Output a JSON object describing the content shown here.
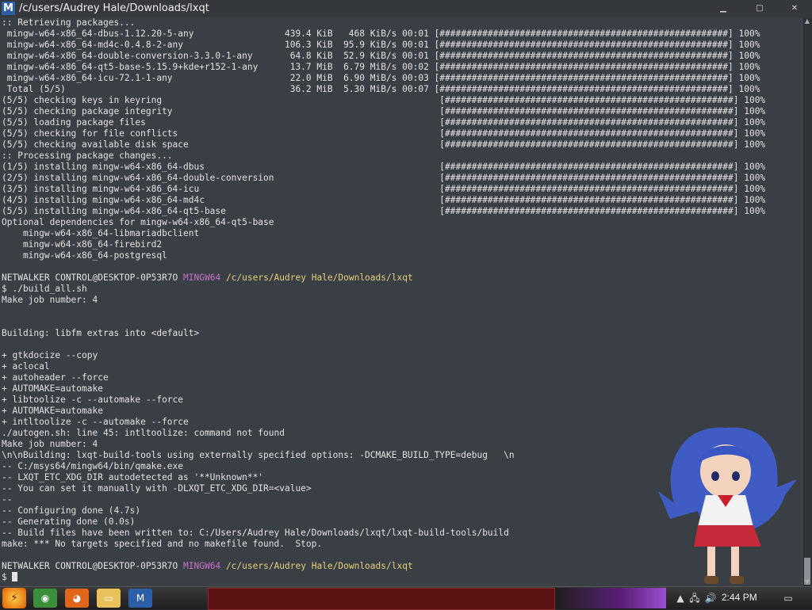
{
  "window": {
    "title": "/c/users/Audrey Hale/Downloads/lxqt",
    "icon_glyph": "M",
    "minimize": "▁",
    "maximize": "□",
    "close": "✕"
  },
  "terminal": {
    "lines": [
      {
        "text": ":: Retrieving packages..."
      },
      {
        "text": " mingw-w64-x86_64-dbus-1.12.20-5-any                 439.4 KiB   468 KiB/s 00:01 [######################################################] 100%"
      },
      {
        "text": " mingw-w64-x86_64-md4c-0.4.8-2-any                   106.3 KiB  95.9 KiB/s 00:01 [######################################################] 100%"
      },
      {
        "text": " mingw-w64-x86_64-double-conversion-3.3.0-1-any       64.8 KiB  52.9 KiB/s 00:01 [######################################################] 100%"
      },
      {
        "text": " mingw-w64-x86_64-qt5-base-5.15.9+kde+r152-1-any      13.7 MiB  6.79 MiB/s 00:02 [######################################################] 100%"
      },
      {
        "text": " mingw-w64-x86_64-icu-72.1-1-any                      22.0 MiB  6.90 MiB/s 00:03 [######################################################] 100%"
      },
      {
        "text": " Total (5/5)                                          36.2 MiB  5.30 MiB/s 00:07 [######################################################] 100%"
      },
      {
        "text": "(5/5) checking keys in keyring                                                    [######################################################] 100%"
      },
      {
        "text": "(5/5) checking package integrity                                                  [######################################################] 100%"
      },
      {
        "text": "(5/5) loading package files                                                       [######################################################] 100%"
      },
      {
        "text": "(5/5) checking for file conflicts                                                 [######################################################] 100%"
      },
      {
        "text": "(5/5) checking available disk space                                               [######################################################] 100%"
      },
      {
        "text": ":: Processing package changes..."
      },
      {
        "text": "(1/5) installing mingw-w64-x86_64-dbus                                            [######################################################] 100%"
      },
      {
        "text": "(2/5) installing mingw-w64-x86_64-double-conversion                               [######################################################] 100%"
      },
      {
        "text": "(3/5) installing mingw-w64-x86_64-icu                                             [######################################################] 100%"
      },
      {
        "text": "(4/5) installing mingw-w64-x86_64-md4c                                            [######################################################] 100%"
      },
      {
        "text": "(5/5) installing mingw-w64-x86_64-qt5-base                                        [######################################################] 100%"
      },
      {
        "text": "Optional dependencies for mingw-w64-x86_64-qt5-base"
      },
      {
        "text": "    mingw-w64-x86_64-libmariadbclient"
      },
      {
        "text": "    mingw-w64-x86_64-firebird2"
      },
      {
        "text": "    mingw-w64-x86_64-postgresql"
      },
      {
        "text": ""
      },
      {
        "prompt": true,
        "host": "NETWALKER CONTROL@DESKTOP-0P53R7O",
        "env": "MINGW64",
        "path": "/c/users/Audrey Hale/Downloads/lxqt"
      },
      {
        "text": "$ ./build_all.sh"
      },
      {
        "text": "Make job number: 4"
      },
      {
        "text": ""
      },
      {
        "text": ""
      },
      {
        "text": "Building: libfm extras into <default>"
      },
      {
        "text": ""
      },
      {
        "text": "+ gtkdocize --copy"
      },
      {
        "text": "+ aclocal"
      },
      {
        "text": "+ autoheader --force"
      },
      {
        "text": "+ AUTOMAKE=automake"
      },
      {
        "text": "+ libtoolize -c --automake --force"
      },
      {
        "text": "+ AUTOMAKE=automake"
      },
      {
        "text": "+ intltoolize -c --automake --force"
      },
      {
        "text": "./autogen.sh: line 45: intltoolize: command not found"
      },
      {
        "text": "Make job number: 4"
      },
      {
        "text": "\\n\\nBuilding: lxqt-build-tools using externally specified options: -DCMAKE_BUILD_TYPE=debug   \\n"
      },
      {
        "text": "-- C:/msys64/mingw64/bin/qmake.exe"
      },
      {
        "text": "-- LXQT_ETC_XDG_DIR autodetected as '**Unknown**'"
      },
      {
        "text": "-- You can set it manually with -DLXQT_ETC_XDG_DIR=<value>"
      },
      {
        "text": "--"
      },
      {
        "text": "-- Configuring done (4.7s)"
      },
      {
        "text": "-- Generating done (0.0s)"
      },
      {
        "text": "-- Build files have been written to: C:/Users/Audrey Hale/Downloads/lxqt/lxqt-build-tools/build"
      },
      {
        "text": "make: *** No targets specified and no makefile found.  Stop."
      },
      {
        "text": ""
      },
      {
        "prompt": true,
        "host": "NETWALKER CONTROL@DESKTOP-0P53R7O",
        "env": "MINGW64",
        "path": "/c/users/Audrey Hale/Downloads/lxqt"
      },
      {
        "text": "$ ",
        "cursor": true
      }
    ]
  },
  "taskbar": {
    "start_glyph": "⚡",
    "pinned": [
      {
        "name": "chrome-icon",
        "glyph": "◉",
        "color": "#3b8f3b"
      },
      {
        "name": "firefox-icon",
        "glyph": "◕",
        "color": "#e0661a"
      },
      {
        "name": "file-explorer-icon",
        "glyph": "▭",
        "color": "#e8c15a"
      },
      {
        "name": "mintty-icon",
        "glyph": "M",
        "color": "#2c5fa8"
      }
    ],
    "clock": "2:44 PM",
    "tray": [
      "▲",
      "🖧",
      "🔊"
    ]
  }
}
